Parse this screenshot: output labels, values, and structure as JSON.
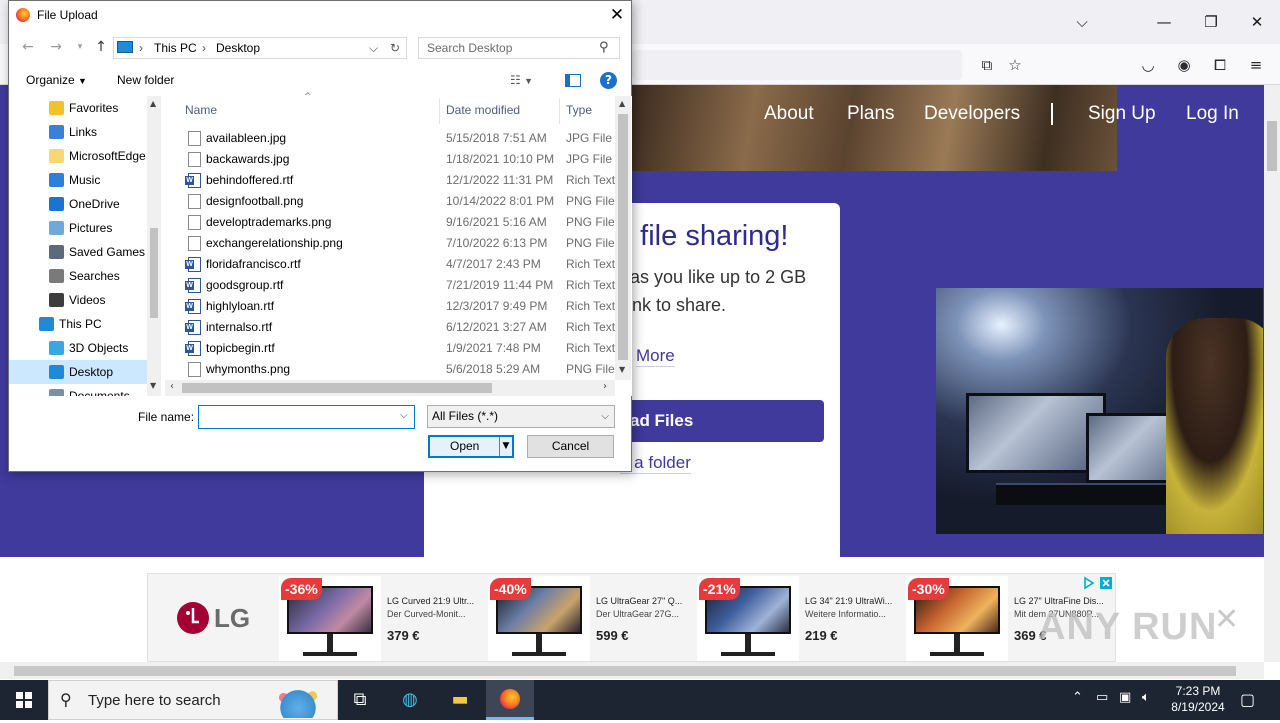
{
  "dialog": {
    "title": "File Upload",
    "address": [
      "This PC",
      "Desktop"
    ],
    "search_placeholder": "Search Desktop",
    "organize_label": "Organize",
    "new_folder_label": "New folder",
    "help_label": "?",
    "tree": [
      {
        "label": "Favorites",
        "icon": "star-icon",
        "color": "#f2c12e"
      },
      {
        "label": "Links",
        "icon": "links-icon",
        "color": "#3b7fd6"
      },
      {
        "label": "MicrosoftEdge",
        "icon": "folder-icon",
        "color": "#f8d775"
      },
      {
        "label": "Music",
        "icon": "music-icon",
        "color": "#2d7fd8"
      },
      {
        "label": "OneDrive",
        "icon": "cloud-icon",
        "color": "#1b73d3"
      },
      {
        "label": "Pictures",
        "icon": "pictures-icon",
        "color": "#6fa9dc"
      },
      {
        "label": "Saved Games",
        "icon": "saved-games-icon",
        "color": "#5b6b7c"
      },
      {
        "label": "Searches",
        "icon": "search-icon",
        "color": "#7a7a7a"
      },
      {
        "label": "Videos",
        "icon": "videos-icon",
        "color": "#3d3d3d"
      },
      {
        "label": "This PC",
        "icon": "computer-icon",
        "color": "#1e8ad8"
      },
      {
        "label": "3D Objects",
        "icon": "cube-icon",
        "color": "#3aa7de"
      },
      {
        "label": "Desktop",
        "icon": "desktop-icon",
        "color": "#1e8ad8"
      },
      {
        "label": "Documents",
        "icon": "documents-icon",
        "color": "#7a8fa8"
      }
    ],
    "columns": {
      "name": "Name",
      "date": "Date modified",
      "type": "Type"
    },
    "files": [
      {
        "name": "availableen.jpg",
        "date": "5/15/2018 7:51 AM",
        "type": "JPG File",
        "kind": "img"
      },
      {
        "name": "backawards.jpg",
        "date": "1/18/2021 10:10 PM",
        "type": "JPG File",
        "kind": "img"
      },
      {
        "name": "behindoffered.rtf",
        "date": "12/1/2022 11:31 PM",
        "type": "Rich Text",
        "kind": "rtf"
      },
      {
        "name": "designfootball.png",
        "date": "10/14/2022 8:01 PM",
        "type": "PNG File",
        "kind": "img"
      },
      {
        "name": "developtrademarks.png",
        "date": "9/16/2021 5:16 AM",
        "type": "PNG File",
        "kind": "img"
      },
      {
        "name": "exchangerelationship.png",
        "date": "7/10/2022 6:13 PM",
        "type": "PNG File",
        "kind": "img"
      },
      {
        "name": "floridafrancisco.rtf",
        "date": "4/7/2017 2:43 PM",
        "type": "Rich Text",
        "kind": "rtf"
      },
      {
        "name": "goodsgroup.rtf",
        "date": "7/21/2019 11:44 PM",
        "type": "Rich Text",
        "kind": "rtf"
      },
      {
        "name": "highlyloan.rtf",
        "date": "12/3/2017 9:49 PM",
        "type": "Rich Text",
        "kind": "rtf"
      },
      {
        "name": "internalso.rtf",
        "date": "6/12/2021 3:27 AM",
        "type": "Rich Text",
        "kind": "rtf"
      },
      {
        "name": "topicbegin.rtf",
        "date": "1/9/2021 7:48 PM",
        "type": "Rich Text",
        "kind": "rtf"
      },
      {
        "name": "whymonths.png",
        "date": "5/6/2018 5:29 AM",
        "type": "PNG File",
        "kind": "img"
      }
    ],
    "file_name_label": "File name:",
    "file_name_value": "",
    "file_type": "All Files (*.*)",
    "open_label": "Open",
    "cancel_label": "Cancel"
  },
  "website": {
    "nav": [
      "About",
      "Plans",
      "Developers",
      "Sign Up",
      "Log In"
    ],
    "heading": "e file sharing!",
    "text_line1": "as you like up to 2 GB",
    "text_line2": "nk to share.",
    "more_link": "More",
    "upload_button": "ad Files",
    "folder_link": "d a folder",
    "accent_color": "#3f3a9b"
  },
  "ad": {
    "brand": "LG",
    "items": [
      {
        "badge": "-36%",
        "title": "LG Curved 21:9 Ultr...",
        "sub": "Der Curved-Monit...",
        "price": "379 €"
      },
      {
        "badge": "-40%",
        "title": "LG UltraGear 27\" Q...",
        "sub": "Der UltraGear 27G...",
        "price": "599 €"
      },
      {
        "badge": "-21%",
        "title": "LG 34\" 21:9 UltraWi...",
        "sub": "Weitere Informatio...",
        "price": "219 €"
      },
      {
        "badge": "-30%",
        "title": "LG 27\" UltraFine Dis...",
        "sub": "Mit dem 27UN880P...",
        "price": "369 €"
      }
    ]
  },
  "watermark": "ANY RUN",
  "taskbar": {
    "search_placeholder": "Type here to search",
    "time": "7:23 PM",
    "date": "8/19/2024"
  }
}
